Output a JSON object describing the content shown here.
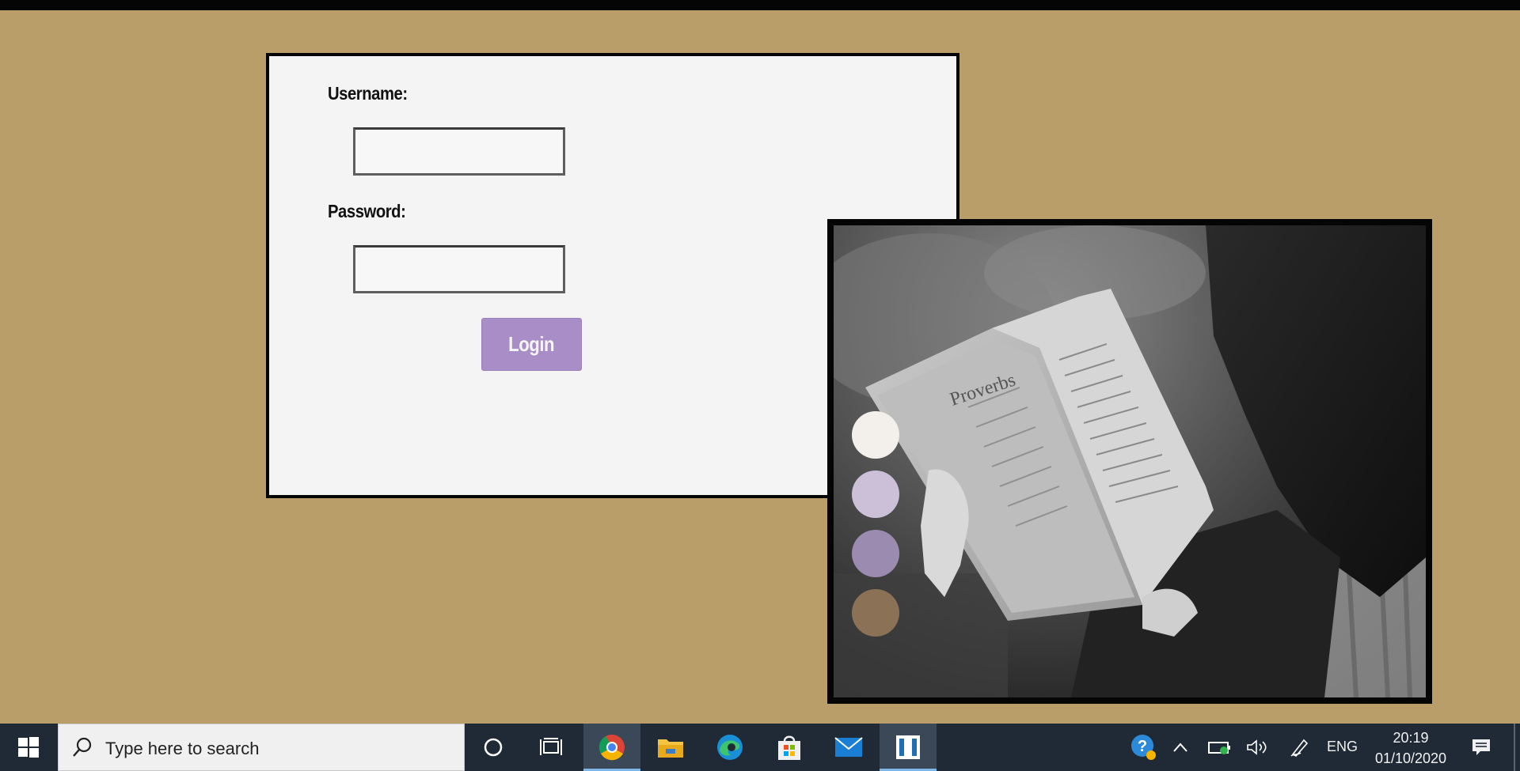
{
  "login": {
    "username_label": "Username:",
    "password_label": "Password:",
    "username_value": "",
    "password_value": "",
    "login_button": "Login"
  },
  "photo": {
    "book_text": "Proverbs",
    "swatches": [
      "#f3f0ec",
      "#cbc0d8",
      "#9c8bb0",
      "#8b7155"
    ]
  },
  "colors": {
    "background": "#b99e69",
    "card": "#f4f4f4",
    "button": "#a98dc6",
    "taskbar": "#1f2a36"
  },
  "taskbar": {
    "search_placeholder": "Type here to search",
    "icons": [
      "windows-start-icon",
      "search-icon",
      "cortana-icon",
      "task-view-icon",
      "chrome-icon",
      "file-explorer-icon",
      "edge-icon",
      "store-icon",
      "mail-icon",
      "app-icon"
    ],
    "language": "ENG",
    "time": "20:19",
    "date": "01/10/2020"
  }
}
